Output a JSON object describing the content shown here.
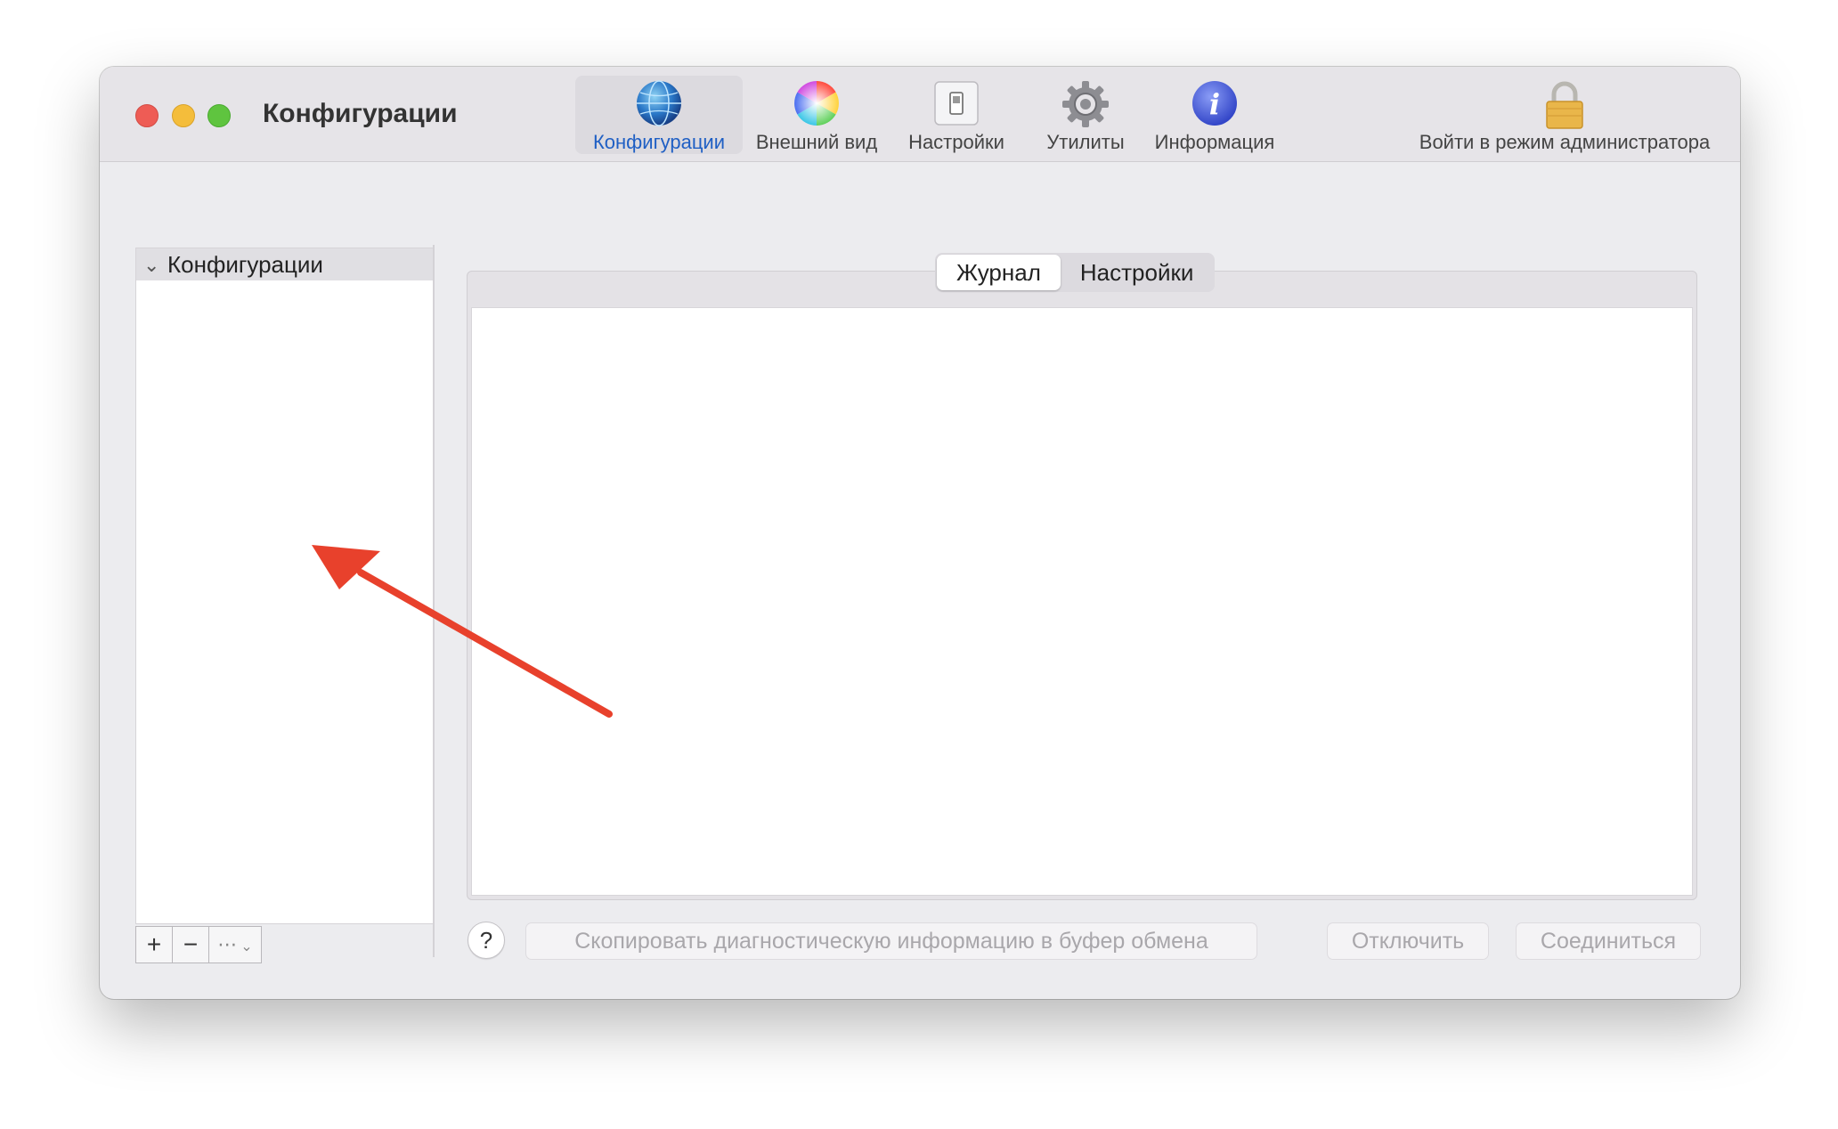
{
  "window": {
    "title": "Конфигурации"
  },
  "toolbar": {
    "items": [
      {
        "label": "Конфигурации",
        "icon": "globe-icon",
        "active": true
      },
      {
        "label": "Внешний вид",
        "icon": "color-wheel-icon",
        "active": false
      },
      {
        "label": "Настройки",
        "icon": "switch-icon",
        "active": false
      },
      {
        "label": "Утилиты",
        "icon": "gear-icon",
        "active": false
      },
      {
        "label": "Информация",
        "icon": "info-icon",
        "active": false
      }
    ],
    "admin": {
      "label": "Войти в режим администратора",
      "icon": "lock-icon"
    }
  },
  "sidebar": {
    "header": "Конфигурации",
    "buttons": {
      "add": "+",
      "remove": "−",
      "more": "⋯"
    }
  },
  "tabs": [
    {
      "label": "Журнал",
      "selected": true
    },
    {
      "label": "Настройки",
      "selected": false
    }
  ],
  "footer": {
    "help": "?",
    "copy": "Скопировать диагностическую информацию в буфер обмена",
    "disconnect": "Отключить",
    "connect": "Соединиться"
  },
  "colors": {
    "accent": "#1f5fc4",
    "annotation_arrow": "#e8412c"
  }
}
